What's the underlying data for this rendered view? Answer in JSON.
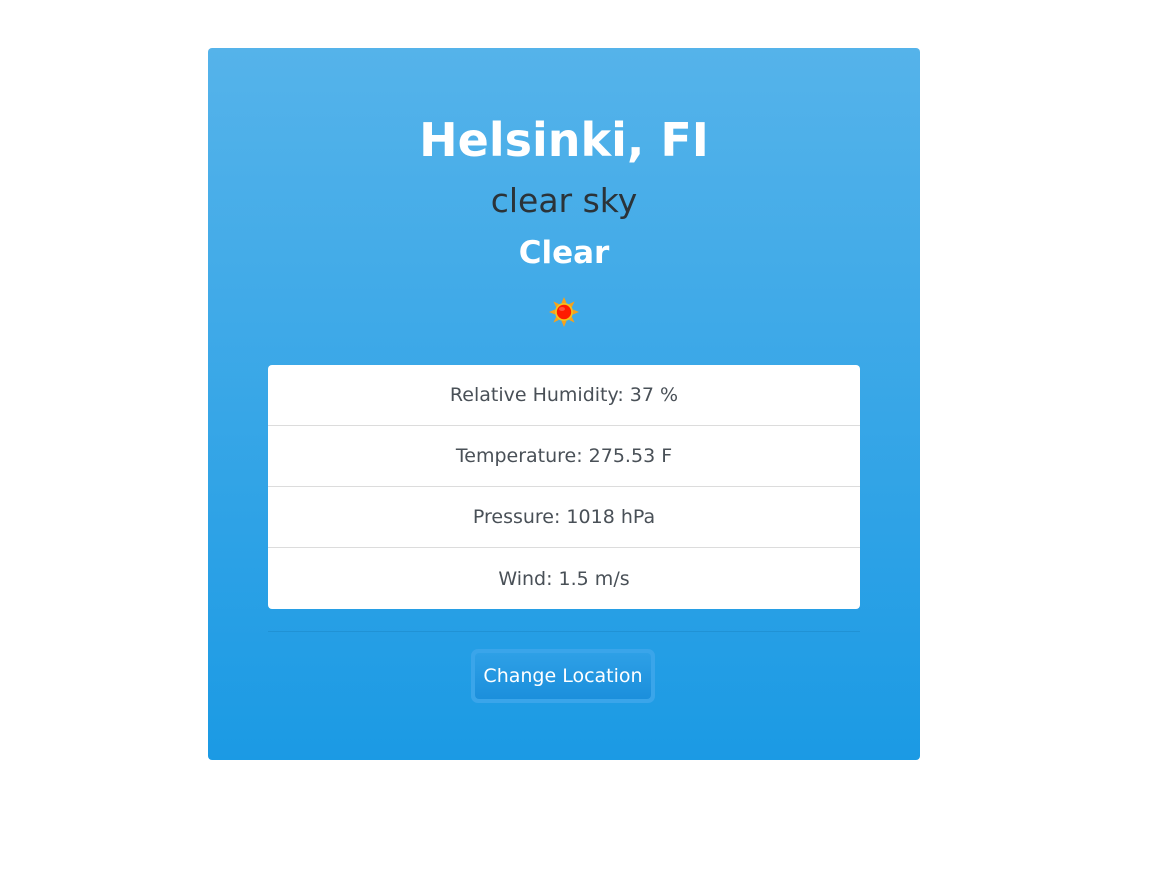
{
  "weather": {
    "location": "Helsinki, FI",
    "description": "clear sky",
    "condition": "Clear",
    "icon": "sun-icon"
  },
  "details": [
    {
      "label": "Relative Humidity: 37 %"
    },
    {
      "label": "Temperature: 275.53 F"
    },
    {
      "label": "Pressure: 1018 hPa"
    },
    {
      "label": "Wind: 1.5 m/s"
    }
  ],
  "actions": {
    "change_location_label": "Change Location"
  },
  "colors": {
    "card_top": "#55b3ea",
    "card_bottom": "#1b9ae4",
    "sun_core": "#ff1a00",
    "sun_rays": "#f7a11a"
  }
}
